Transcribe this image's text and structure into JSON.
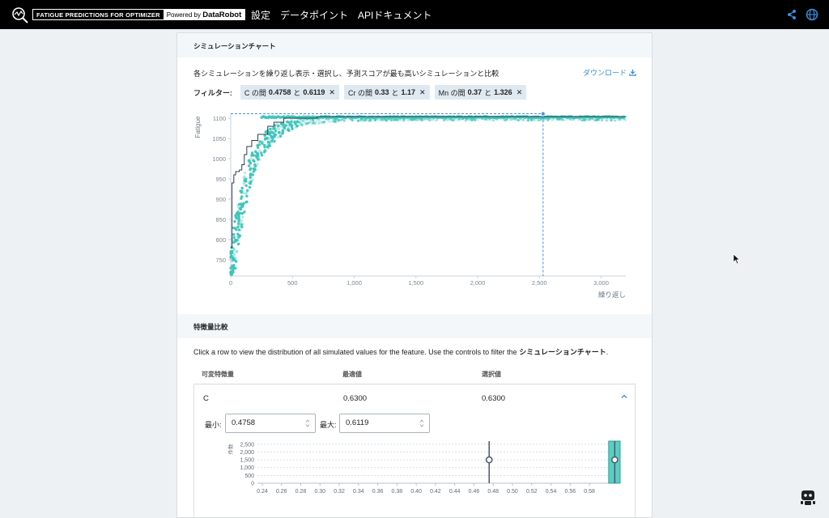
{
  "header": {
    "brand_title": "FATIGUE PREDICTIONS FOR OPTIMIZER",
    "powered_prefix": "Powered by",
    "powered_brand": "DataRobot",
    "nav": [
      "設定",
      "データポイント",
      "APIドキュメント"
    ]
  },
  "simulation": {
    "section_title": "シミュレーションチャート",
    "description": "各シミュレーションを繰り返し表示・選択し、予測スコアが最も高いシミュレーションと比較",
    "download_label": "ダウンロード",
    "filter_label": "フィルター:",
    "filters": [
      {
        "prefix": "C の間",
        "low": "0.4758",
        "mid": "と",
        "high": "0.6119"
      },
      {
        "prefix": "Cr の間",
        "low": "0.33",
        "mid": "と",
        "high": "1.17"
      },
      {
        "prefix": "Mn の間",
        "low": "0.37",
        "mid": "と",
        "high": "1.326"
      }
    ]
  },
  "chart_data": [
    {
      "type": "scatter",
      "title": "",
      "xlabel": "繰り返し",
      "ylabel": "Fatigue",
      "xlim": [
        0,
        3200
      ],
      "ylim": [
        710,
        1110
      ],
      "x_ticks": [
        "0",
        "500",
        "1,000",
        "1,500",
        "2,000",
        "2,500",
        "3,000"
      ],
      "x_tick_values": [
        0,
        500,
        1000,
        1500,
        2000,
        2500,
        3000
      ],
      "y_ticks": [
        "750",
        "800",
        "850",
        "900",
        "950",
        "1000",
        "1050",
        "1100"
      ],
      "y_tick_values": [
        750,
        800,
        850,
        900,
        950,
        1000,
        1050,
        1100
      ],
      "selected_iteration": 2530,
      "best_value": 1105,
      "colors": {
        "points": "#3cc4b9",
        "best_line": "#2d3e4e",
        "selection": "#4a90d9"
      },
      "best_so_far": [
        [
          0,
          780
        ],
        [
          10,
          940
        ],
        [
          25,
          960
        ],
        [
          40,
          968
        ],
        [
          70,
          972
        ],
        [
          90,
          985
        ],
        [
          110,
          1010
        ],
        [
          130,
          1030
        ],
        [
          170,
          1045
        ],
        [
          220,
          1060
        ],
        [
          300,
          1080
        ],
        [
          350,
          1090
        ],
        [
          430,
          1100
        ],
        [
          700,
          1104
        ],
        [
          3200,
          1105
        ]
      ]
    },
    {
      "type": "bar",
      "title": "",
      "ylabel": "件数",
      "xlim": [
        0.235,
        0.6119
      ],
      "x_ticks": [
        "0.24",
        "0.26",
        "0.28",
        "0.30",
        "0.32",
        "0.34",
        "0.36",
        "0.38",
        "0.40",
        "0.42",
        "0.44",
        "0.46",
        "0.48",
        "0.50",
        "0.52",
        "0.54",
        "0.56",
        "0.58"
      ],
      "y_ticks": [
        "2,500",
        "2,000",
        "1,500",
        "1,000",
        "500",
        "0"
      ],
      "ylim": [
        0,
        2700
      ],
      "bars": [
        {
          "x0": 0.6,
          "x1": 0.6119,
          "value": 2700
        }
      ],
      "markers": [
        {
          "x": 0.4758,
          "value": 1500
        },
        {
          "x": 0.6063,
          "value": 1500
        }
      ],
      "colors": {
        "bar": "#58cfc4",
        "marker": "#4a5a68"
      }
    }
  ],
  "features": {
    "section_title": "特徴量比較",
    "description_prefix": "Click a row to view the distribution of all simulated values for the feature. Use the controls to filter the",
    "description_link": "シミュレーションチャート",
    "description_suffix": ".",
    "columns": [
      "可変特徴量",
      "最適値",
      "選択値"
    ],
    "row": {
      "name": "C",
      "optimal": "0.6300",
      "selected": "0.6300"
    },
    "min_label": "最小:",
    "min_value": "0.4758",
    "max_label": "最大:",
    "max_value": "0.6119"
  }
}
